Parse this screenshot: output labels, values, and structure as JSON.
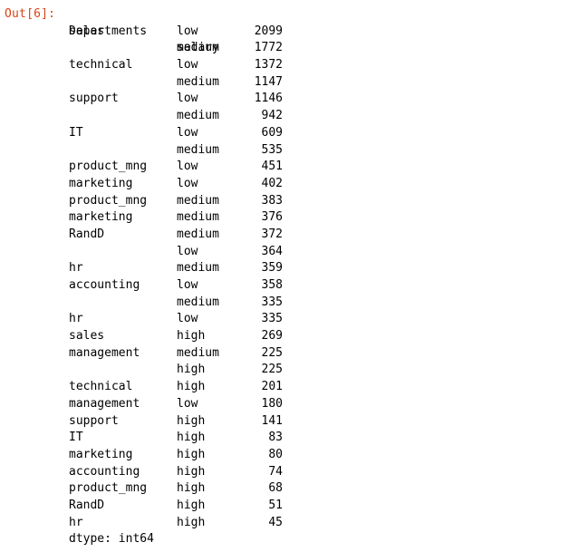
{
  "cell": {
    "prompt": "Out[6]:",
    "header": {
      "index0": "Departments",
      "index1": "salary"
    },
    "rows": [
      {
        "department": "sales",
        "salary": "low",
        "count": "2099"
      },
      {
        "department": "",
        "salary": "medium",
        "count": "1772"
      },
      {
        "department": "technical",
        "salary": "low",
        "count": "1372"
      },
      {
        "department": "",
        "salary": "medium",
        "count": "1147"
      },
      {
        "department": "support",
        "salary": "low",
        "count": "1146"
      },
      {
        "department": "",
        "salary": "medium",
        "count": "942"
      },
      {
        "department": "IT",
        "salary": "low",
        "count": "609"
      },
      {
        "department": "",
        "salary": "medium",
        "count": "535"
      },
      {
        "department": "product_mng",
        "salary": "low",
        "count": "451"
      },
      {
        "department": "marketing",
        "salary": "low",
        "count": "402"
      },
      {
        "department": "product_mng",
        "salary": "medium",
        "count": "383"
      },
      {
        "department": "marketing",
        "salary": "medium",
        "count": "376"
      },
      {
        "department": "RandD",
        "salary": "medium",
        "count": "372"
      },
      {
        "department": "",
        "salary": "low",
        "count": "364"
      },
      {
        "department": "hr",
        "salary": "medium",
        "count": "359"
      },
      {
        "department": "accounting",
        "salary": "low",
        "count": "358"
      },
      {
        "department": "",
        "salary": "medium",
        "count": "335"
      },
      {
        "department": "hr",
        "salary": "low",
        "count": "335"
      },
      {
        "department": "sales",
        "salary": "high",
        "count": "269"
      },
      {
        "department": "management",
        "salary": "medium",
        "count": "225"
      },
      {
        "department": "",
        "salary": "high",
        "count": "225"
      },
      {
        "department": "technical",
        "salary": "high",
        "count": "201"
      },
      {
        "department": "management",
        "salary": "low",
        "count": "180"
      },
      {
        "department": "support",
        "salary": "high",
        "count": "141"
      },
      {
        "department": "IT",
        "salary": "high",
        "count": "83"
      },
      {
        "department": "marketing",
        "salary": "high",
        "count": "80"
      },
      {
        "department": "accounting",
        "salary": "high",
        "count": "74"
      },
      {
        "department": "product_mng",
        "salary": "high",
        "count": "68"
      },
      {
        "department": "RandD",
        "salary": "high",
        "count": "51"
      },
      {
        "department": "hr",
        "salary": "high",
        "count": "45"
      }
    ],
    "dtype": "dtype: int64"
  }
}
